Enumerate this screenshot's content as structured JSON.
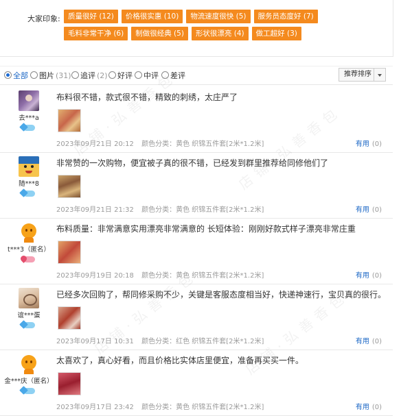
{
  "impressions": {
    "label": "大家印象:",
    "tags": [
      "质量很好 (12)",
      "价格很实惠 (10)",
      "物流速度很快 (5)",
      "服务员态度好 (7)",
      "毛料非常干净 (6)",
      "制做很经典 (5)",
      "形状很漂亮 (4)",
      "做工超好 (3)"
    ],
    "tag_color": "#f48a1e"
  },
  "filter": {
    "options": [
      {
        "label": "全部",
        "count": "",
        "selected": true
      },
      {
        "label": "图片",
        "count": "(31)",
        "selected": false
      },
      {
        "label": "追评",
        "count": "(2)",
        "selected": false
      },
      {
        "label": "好评",
        "count": "",
        "selected": false
      },
      {
        "label": "中评",
        "count": "",
        "selected": false
      },
      {
        "label": "差评",
        "count": "",
        "selected": false
      }
    ],
    "sort_label": "推荐排序"
  },
  "reviews": [
    {
      "user": "去***a",
      "anon": "",
      "badge": "diamond",
      "avatar": "purple-photo",
      "text": "布料很不错，款式很不错，精致的刺绣，太庄严了",
      "date": "2023年09月21日 20:12",
      "variant": "颜色分类：黄色 织锦五件套[2米*1.2米]",
      "useful_label": "有用",
      "useful_count": "(0)"
    },
    {
      "user": "随***8",
      "anon": "",
      "badge": "diamond",
      "avatar": "cartoon",
      "text": "非常赞的一次购物，便宜被子真的很不错，已经发到群里推荐给同修他们了",
      "date": "2023年09月21日 21:32",
      "variant": "颜色分类：黄色 织锦五件套[2米*1.2米]",
      "useful_label": "有用",
      "useful_count": "(0)"
    },
    {
      "user": "t***3",
      "anon": "（匿名）",
      "badge": "heart",
      "avatar": "default",
      "text": "布料质量：非常满意实用漂亮非常满意的 长短体验：刚刚好款式样子漂亮非常庄重",
      "date": "2023年09月19日 20:18",
      "variant": "颜色分类：黄色 织锦五件套[2米*1.2米]",
      "useful_label": "有用",
      "useful_count": "(0)"
    },
    {
      "user": "谊***蛋",
      "anon": "",
      "badge": "diamond",
      "avatar": "hand-photo",
      "text": "已经多次回购了，帮同修采购不少，关键是客服态度相当好，快递神速行，宝贝真的很行。",
      "date": "2023年09月17日 10:31",
      "variant": "颜色分类：红色 织锦五件套[2米*1.2米]",
      "useful_label": "有用",
      "useful_count": "(0)"
    },
    {
      "user": "金***庆",
      "anon": "（匿名）",
      "badge": "diamond",
      "avatar": "default",
      "text": "太喜欢了，真心好看，而且价格比实体店里便宜，准备再买买一件。",
      "date": "2023年09月17日 23:42",
      "variant": "颜色分类：黄色 织锦五件套[2米*1.2米]",
      "useful_label": "有用",
      "useful_count": "(0)"
    }
  ]
}
